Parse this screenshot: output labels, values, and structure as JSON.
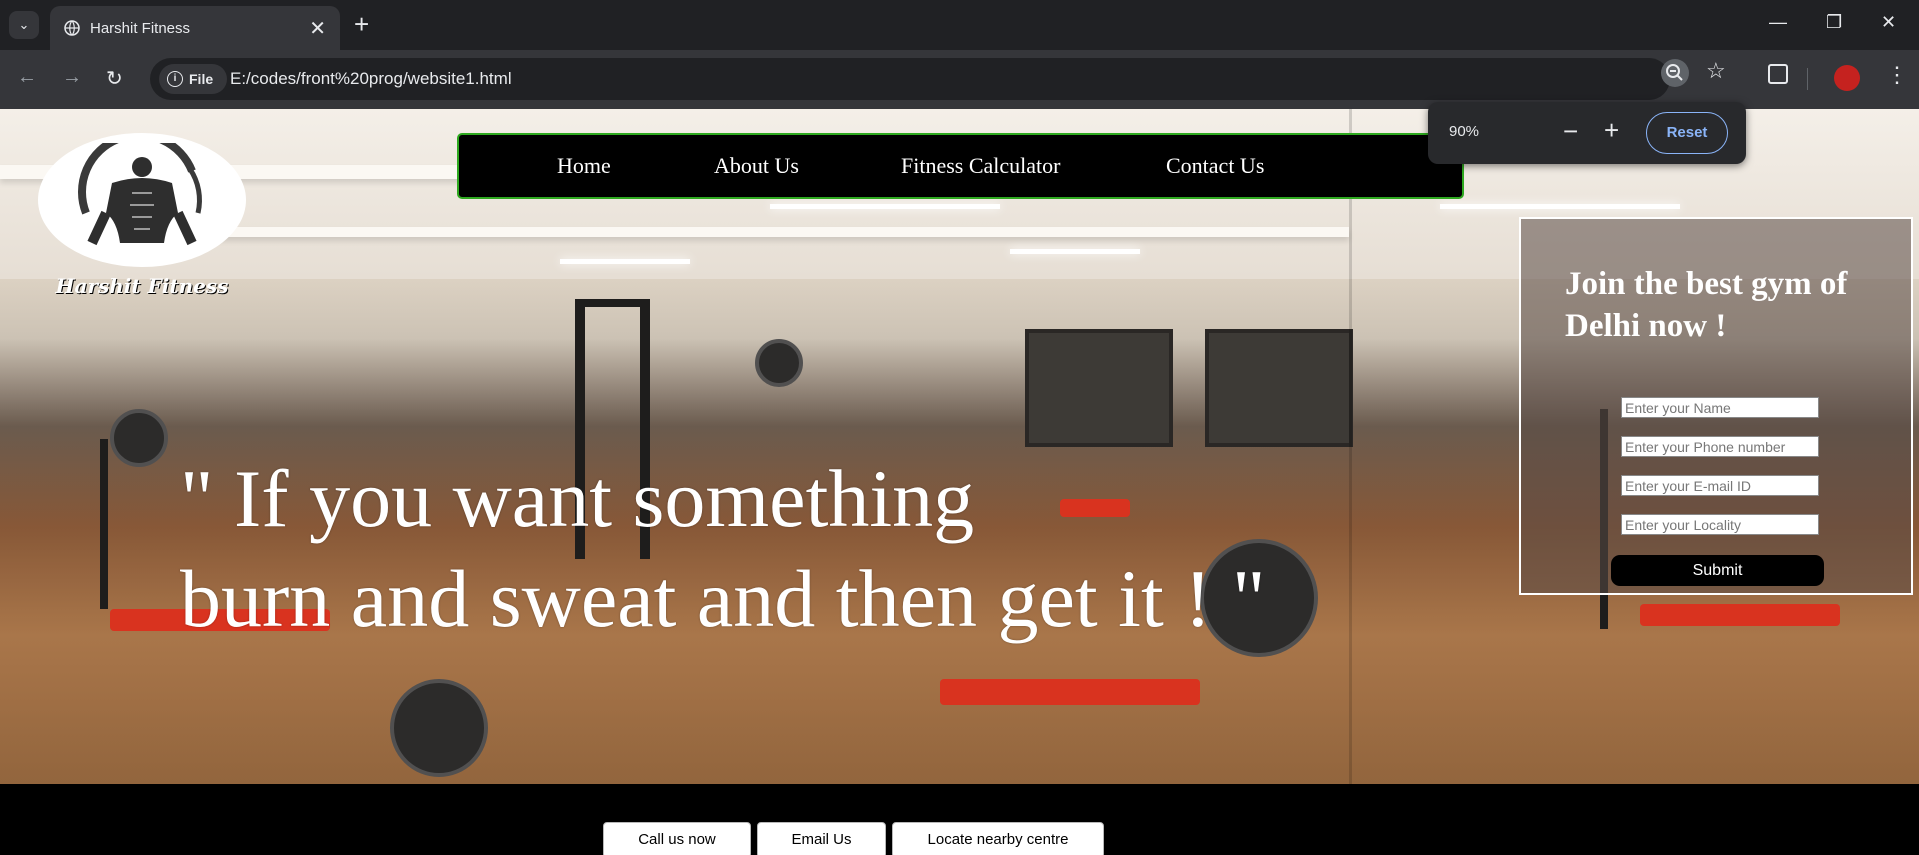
{
  "browser": {
    "tab_title": "Harshit Fitness",
    "new_tab_symbol": "+",
    "tab_close_symbol": "✕",
    "url": "E:/codes/front%20prog/website1.html",
    "file_chip": "File",
    "zoom_popup": {
      "level": "90%",
      "minus": "−",
      "plus": "+",
      "reset_label": "Reset"
    },
    "icons": [
      "tab-search-icon",
      "globe-icon",
      "back-icon",
      "forward-icon",
      "reload-icon",
      "info-icon",
      "zoom-icon",
      "star-icon",
      "extensions-icon",
      "profile-avatar",
      "menu-kebab-icon",
      "minimize-icon",
      "restore-icon",
      "close-window-icon"
    ]
  },
  "site": {
    "brand_name": "Harshit Fitness",
    "nav": [
      {
        "label": "Home"
      },
      {
        "label": "About Us"
      },
      {
        "label": "Fitness Calculator"
      },
      {
        "label": "Contact Us"
      }
    ],
    "quote_line1": "\" If you want something",
    "quote_line2": "burn and sweat and then get it ! \"",
    "form": {
      "title": "Join the best gym of Delhi now !",
      "name_placeholder": "Enter your Name",
      "phone_placeholder": "Enter your Phone number",
      "email_placeholder": "Enter your E-mail ID",
      "locality_placeholder": "Enter your Locality",
      "submit_label": "Submit"
    },
    "footer_buttons": [
      {
        "label": "Call us now"
      },
      {
        "label": "Email Us"
      },
      {
        "label": "Locate nearby centre"
      }
    ]
  },
  "colors": {
    "nav_border": "#2ea91f",
    "chrome_dark": "#202124",
    "chrome_toolbar": "#35363a",
    "accent_blue": "#8ab4f8"
  }
}
